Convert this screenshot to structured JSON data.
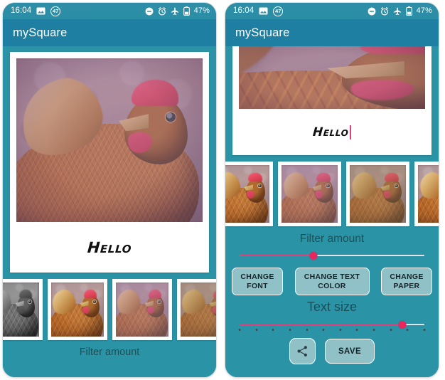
{
  "app": {
    "title": "mySquare",
    "accent_teal": "#2b93a6",
    "appbar_teal": "#1f7fa3",
    "accent_pink": "#e8275f",
    "button_fill": "#8fc1c7"
  },
  "status_bar": {
    "time": "16:04",
    "battery_percent": "47%",
    "notification_count": "47",
    "icons": [
      "image-icon",
      "notification-count-badge",
      "do-not-disturb-icon",
      "alarm-clock-icon",
      "airplane-mode-icon",
      "battery-icon"
    ]
  },
  "left_panel": {
    "caption": "Hello",
    "filter_label": "Filter amount",
    "thumbnails": [
      {
        "name": "filter-thumb-grayscale",
        "filter": "gray"
      },
      {
        "name": "filter-thumb-warm",
        "filter": "warm"
      },
      {
        "name": "filter-thumb-purple",
        "filter": "purple"
      },
      {
        "name": "filter-thumb-sepia",
        "filter": "sepia"
      }
    ]
  },
  "right_panel": {
    "caption": "Hello",
    "filter_label": "Filter amount",
    "text_size_label": "Text size",
    "filter_slider": {
      "value_percent": 40
    },
    "text_size_slider": {
      "value_percent": 88,
      "tick_count": 12
    },
    "buttons": {
      "change_font": "CHANGE FONT",
      "change_text_color": "CHANGE TEXT COLOR",
      "change_paper": "CHANGE PAPER",
      "save": "SAVE",
      "share_icon": "share-icon"
    },
    "thumbnails": [
      {
        "name": "filter-thumb-warm",
        "filter": "warm"
      },
      {
        "name": "filter-thumb-purple",
        "filter": "purple"
      },
      {
        "name": "filter-thumb-sepia",
        "filter": "sepia"
      },
      {
        "name": "filter-thumb-warm2",
        "filter": "warm"
      }
    ]
  }
}
